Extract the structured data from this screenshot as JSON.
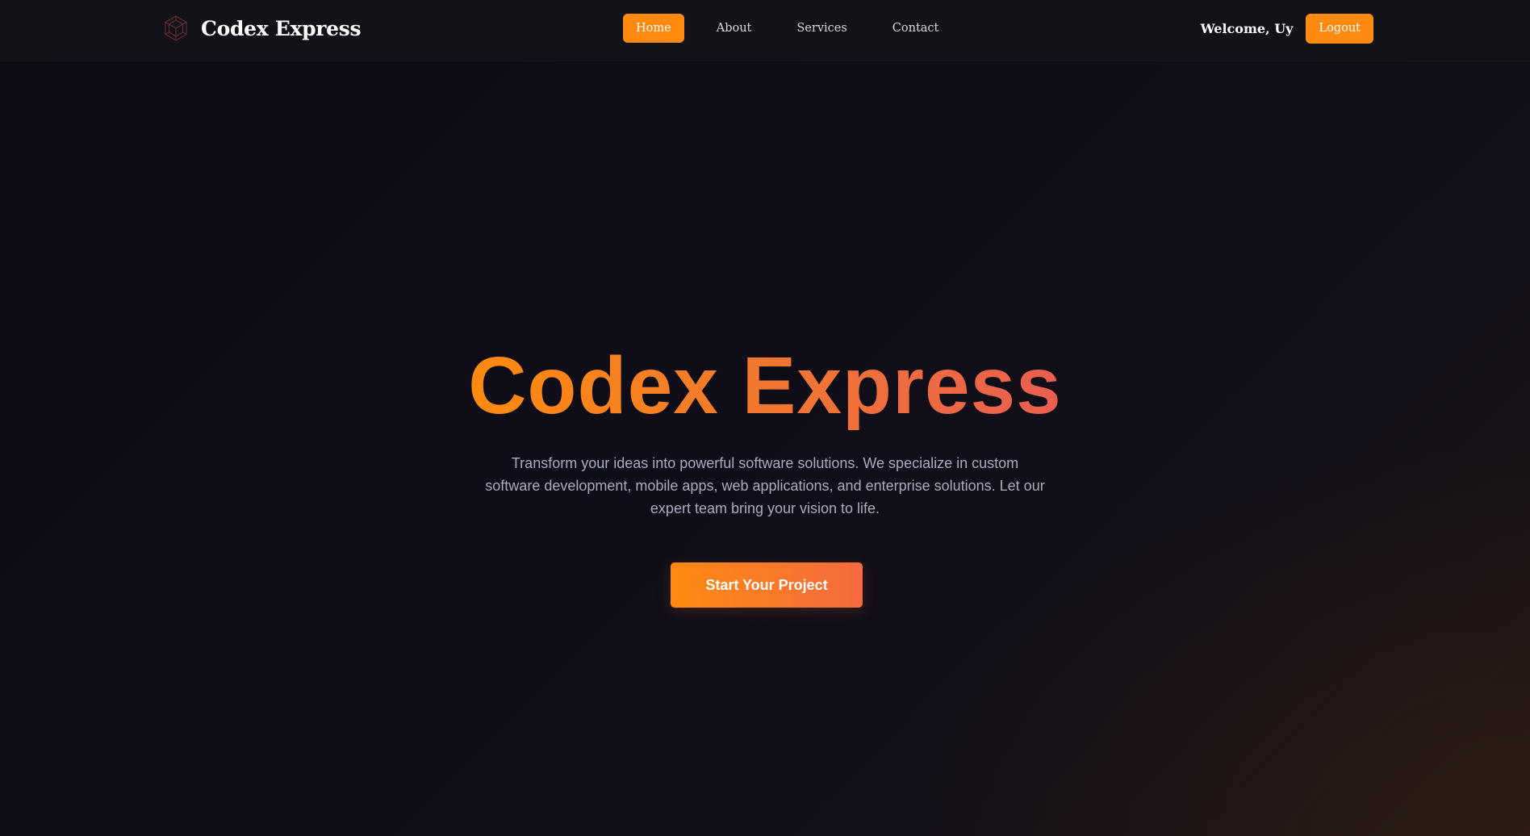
{
  "header": {
    "brand_name": "Codex Express",
    "logo_icon": "hexagon-cube-logo-icon",
    "nav": [
      {
        "label": "Home",
        "active": true
      },
      {
        "label": "About",
        "active": false
      },
      {
        "label": "Services",
        "active": false
      },
      {
        "label": "Contact",
        "active": false
      }
    ],
    "welcome_text": "Welcome, Uy",
    "logout_label": "Logout"
  },
  "hero": {
    "title": "Codex Express",
    "subtitle": "Transform your ideas into powerful software solutions. We specialize in custom software development, mobile apps, web applications, and enterprise solutions. Let our expert team bring your vision to life.",
    "cta_label": "Start Your Project"
  },
  "colors": {
    "accent": "#ff8a0f",
    "accent_end": "#ea5e50",
    "background": "#0d0d16",
    "navbar": "#121219",
    "subtitle_text": "#a9acbd"
  }
}
